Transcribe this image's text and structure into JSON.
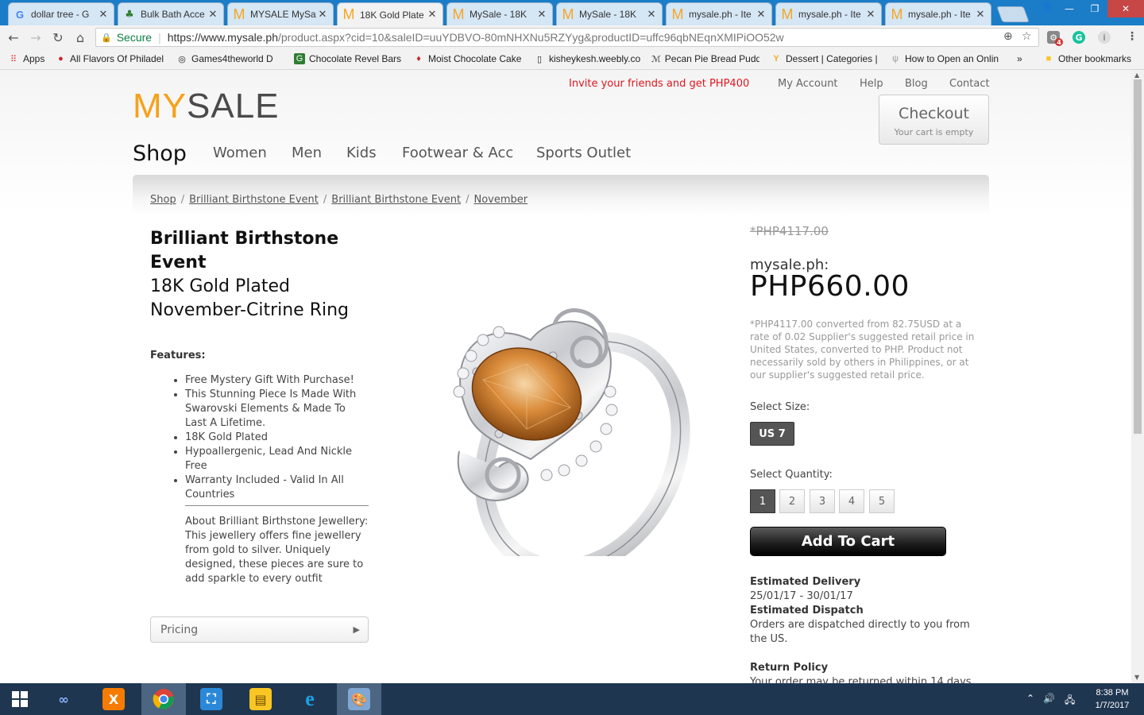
{
  "browser": {
    "tabs": [
      {
        "title": "dollar tree - G",
        "icon": "google-icon"
      },
      {
        "title": "Bulk Bath Acce",
        "icon": "palm-icon"
      },
      {
        "title": "MYSALE MySa",
        "icon": "mysale-icon"
      },
      {
        "title": "18K Gold Plate",
        "icon": "mysale-icon",
        "active": true
      },
      {
        "title": "MySale - 18K",
        "icon": "mysale-icon"
      },
      {
        "title": "MySale - 18K",
        "icon": "mysale-icon"
      },
      {
        "title": "mysale.ph - Ite",
        "icon": "mysale-icon"
      },
      {
        "title": "mysale.ph - Ite",
        "icon": "mysale-icon"
      },
      {
        "title": "mysale.ph - Ite",
        "icon": "mysale-icon"
      }
    ],
    "secure_label": "Secure",
    "url_main": "https://www.mysale.ph",
    "url_rest": "/product.aspx?cid=10&saleID=uuYDBVO-80mNHXNu5RZYyg&productID=uffc96qbNEqnXMIPiOO52w",
    "extension_badge": "4",
    "bookmarks": [
      {
        "label": "Apps"
      },
      {
        "label": "All Flavors Of Philadel"
      },
      {
        "label": "Games4theworld D"
      },
      {
        "label": "Chocolate Revel Bars"
      },
      {
        "label": "Moist Chocolate Cake"
      },
      {
        "label": "kisheykesh.weebly.co"
      },
      {
        "label": "Pecan Pie Bread Pudd"
      },
      {
        "label": "Dessert | Categories |"
      },
      {
        "label": "How to Open an Onlin"
      }
    ],
    "bookmarks_more": "»",
    "other_bookmarks": "Other bookmarks"
  },
  "site": {
    "logo_my": "MY",
    "logo_sale": "SALE",
    "invite": "Invite your friends and get PHP400",
    "top_links": [
      "My Account",
      "Help",
      "Blog",
      "Contact"
    ],
    "checkout_title": "Checkout",
    "checkout_sub": "Your cart is empty",
    "shop_label": "Shop",
    "nav": [
      "Women",
      "Men",
      "Kids",
      "Footwear & Acc",
      "Sports Outlet"
    ],
    "breadcrumbs": [
      "Shop",
      "Brilliant Birthstone Event",
      "Brilliant Birthstone Event",
      "November"
    ]
  },
  "product": {
    "brand": "Brilliant Birthstone Event",
    "name": "18K Gold Plated November-Citrine Ring",
    "features_heading": "Features:",
    "features": [
      "Free Mystery Gift With Purchase!",
      "This Stunning Piece Is Made With Swarovski Elements & Made To Last A Lifetime.",
      "18K Gold Plated",
      "Hypoallergenic, Lead And Nickle Free",
      "Warranty Included - Valid In All Countries"
    ],
    "about": "About Brilliant Birthstone Jewellery: This jewellery offers fine jewellery from gold to silver. Uniquely designed, these pieces are sure to add sparkle to every outfit",
    "pricing_label": "Pricing",
    "old_price": "*PHP4117.00",
    "seller_label": "mysale.ph:",
    "price": "PHP660.00",
    "disclaimer": "*PHP4117.00 converted from 82.75USD at a rate of 0.02 Supplier's suggested retail price in United States, converted to PHP. Product not necessarily sold by others in Philippines, or at our supplier's suggested retail price.",
    "size_label": "Select Size:",
    "size_value": "US 7",
    "qty_label": "Select Quantity:",
    "quantities": [
      "1",
      "2",
      "3",
      "4",
      "5"
    ],
    "selected_qty": "1",
    "add_to_cart": "Add To Cart",
    "delivery_label": "Estimated Delivery",
    "delivery_value": "25/01/17 - 30/01/17",
    "dispatch_label": "Estimated Dispatch",
    "dispatch_value": "Orders are dispatched directly to you from the US.",
    "return_label": "Return Policy",
    "return_value": "Your order may be returned within 14 days"
  },
  "taskbar": {
    "time": "8:38 PM",
    "date": "1/7/2017"
  },
  "colors": {
    "accent_orange": "#f5a21c",
    "invite_red": "#e0171f",
    "titlebar_blue": "#1b7cc7",
    "taskbar": "#1f3651",
    "gem_citrine": "#d98b3a"
  }
}
